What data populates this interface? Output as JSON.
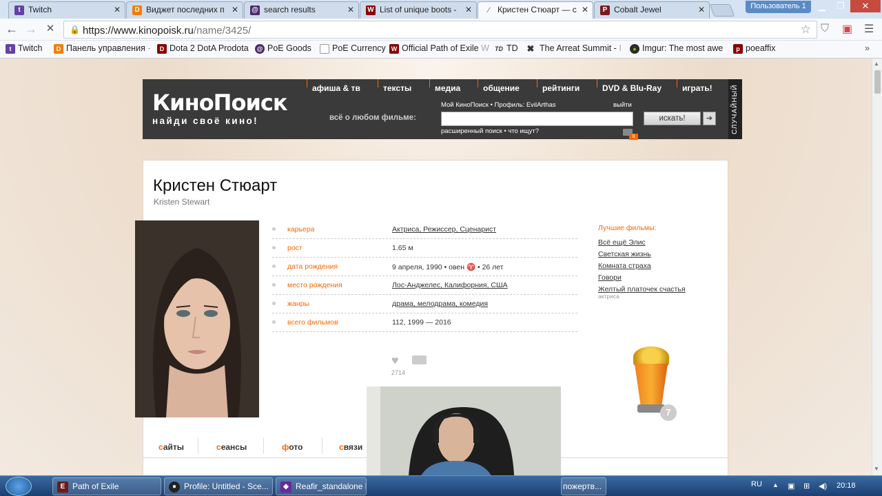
{
  "browser": {
    "tabs": [
      {
        "title": "Twitch",
        "icon": "twitch-icon",
        "color": "#6441a4"
      },
      {
        "title": "Виджет последних п",
        "icon": "donationalerts-icon",
        "color": "#f57d07"
      },
      {
        "title": "search results",
        "icon": "poe-icon",
        "color": "#4a2a6a"
      },
      {
        "title": "List of unique boots -",
        "icon": "wiki-icon",
        "color": "#8b0000"
      },
      {
        "title": "Кристен Стюарт — с",
        "icon": "loading-icon",
        "color": "#888888"
      },
      {
        "title": "Cobalt Jewel",
        "icon": "poe-icon",
        "color": "#7a1a1a"
      }
    ],
    "user_label": "Пользователь 1",
    "url_host": "https://www.kinopoisk.ru",
    "url_path": "/name/3425/",
    "bookmarks": [
      {
        "label": "Twitch",
        "icon": "twitch-icon",
        "color": "#6441a4"
      },
      {
        "label": "Панель управления",
        "label_fade": " -",
        "icon": "donationalerts-icon",
        "color": "#f57d07"
      },
      {
        "label": "Dota 2 DotA Prodota",
        "icon": "prodota-icon",
        "color": "#8b0000"
      },
      {
        "label": "PoE Goods",
        "icon": "poe-icon",
        "color": "#4a2a6a"
      },
      {
        "label": "PoE Currency",
        "icon": "page-icon",
        "color": "#999999"
      },
      {
        "label": "Official Path of Exile",
        "label_fade": " W",
        "icon": "wiki-icon",
        "color": "#8b0000"
      },
      {
        "label": "TD",
        "icon": "td-icon",
        "color": "#333333"
      },
      {
        "label": "The Arreat Summit -",
        "label_fade": " I",
        "icon": "arreat-icon",
        "color": "#333333"
      },
      {
        "label": "Imgur: The most awe",
        "icon": "imgur-icon",
        "color": "#2b2b2b"
      },
      {
        "label": "poeaffix",
        "icon": "poeaffix-icon",
        "color": "#8b0000"
      }
    ]
  },
  "kp": {
    "logo": "КиноПоиск",
    "slogan": "найди своё кино!",
    "menu": [
      "афиша & тв",
      "тексты",
      "медиа",
      "общение",
      "рейтинги",
      "DVD & Blu-Ray",
      "играть!"
    ],
    "all_about": "всё о любом фильме:",
    "user_line": "Мой КиноПоиск • Профиль: EvilArthas",
    "exit": "выйти",
    "search_btn": "искать!",
    "advanced": "расширенный поиск • что ищут?",
    "notif_count": "8",
    "random": "СЛУЧАЙНЫЙ"
  },
  "person": {
    "name": "Кристен Стюарт",
    "original": "Kristen Stewart",
    "info": [
      {
        "label": "карьера",
        "value": "Актриса, Режиссер, Сценарист"
      },
      {
        "label": "рост",
        "value": "1.65 м"
      },
      {
        "label": "дата рождения",
        "value": "9 апреля, 1990 • овен ♈ • 26 лет"
      },
      {
        "label": "место рождения",
        "value": "Лос-Анджелес, Калифорния, США"
      },
      {
        "label": "жанры",
        "value": "драма, мелодрама, комедия"
      },
      {
        "label": "всего фильмов",
        "value": "112, 1999 — 2016"
      }
    ],
    "best_title": "Лучшие фильмы:",
    "best": [
      "Всё ещё Элис",
      "Светская жизнь",
      "Комната страха",
      "Говори",
      "Желтый платочек счастья"
    ],
    "best_sub": "актриса",
    "likes": "2714",
    "award_count": "7",
    "tabs": [
      {
        "first": "с",
        "rest": "айты"
      },
      {
        "first": "с",
        "rest": "еансы"
      },
      {
        "first": "ф",
        "rest": "ото"
      },
      {
        "first": "с",
        "rest": "вязи"
      }
    ]
  },
  "taskbar": {
    "items": [
      {
        "label": "Path of Exile",
        "icon": "poe-taskbar-icon",
        "color": "#6b1b1b"
      },
      {
        "label": "Profile: Untitled - Sce...",
        "icon": "obs-icon",
        "color": "#222222"
      },
      {
        "label": "Reafir_standalone P",
        "icon": "reafir-icon",
        "color": "#6a2a9a"
      },
      {
        "label": "пожертв...",
        "icon": "browser-icon",
        "color": "#3a6aa2"
      }
    ],
    "lang": "RU",
    "time": "20:18"
  }
}
